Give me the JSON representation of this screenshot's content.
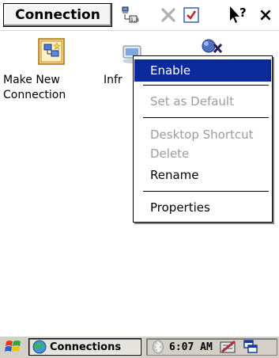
{
  "window": {
    "title": "Connection"
  },
  "toolbar": {
    "icons": [
      "network-settings-icon",
      "delete-icon",
      "checkbox-icon",
      "help-icon",
      "close-icon"
    ],
    "close_label": "×",
    "help_label": "?"
  },
  "items": [
    {
      "label_line1": "Make New",
      "label_line2": "Connection",
      "icon": "make-new-connection-icon"
    },
    {
      "label_line1": "Infr",
      "label_line2": "",
      "icon": "infrared-connection-icon"
    },
    {
      "label_line1": "",
      "label_line2": "",
      "icon": "disabled-connection-icon"
    }
  ],
  "context_menu": {
    "items": [
      {
        "label": "Enable",
        "state": "selected"
      },
      {
        "label": "Set as Default",
        "state": "disabled"
      },
      {
        "label": "Desktop Shortcut",
        "state": "disabled"
      },
      {
        "label": "Delete",
        "state": "disabled"
      },
      {
        "label": "Rename",
        "state": "enabled"
      },
      {
        "label": "Properties",
        "state": "enabled"
      }
    ]
  },
  "taskbar": {
    "task_label": "Connections",
    "clock": "6:07 AM",
    "icons": [
      "start-icon",
      "connections-task-icon",
      "bluetooth-icon",
      "input-panel-icon",
      "desktop-switch-icon"
    ]
  },
  "colors": {
    "menu_highlight": "#0a2a9c",
    "disabled_text": "#9c9c9c",
    "taskbar_bg": "#d4d0c8"
  }
}
